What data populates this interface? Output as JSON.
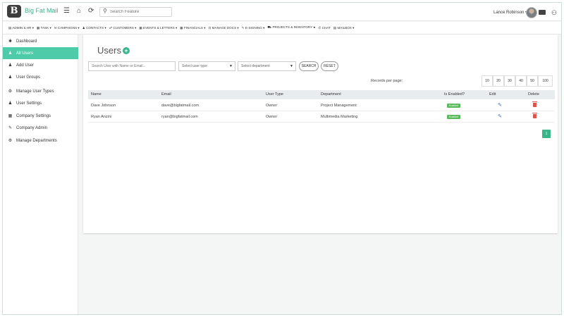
{
  "app": {
    "brand": "Big Fat Mail",
    "logo_letter": "B"
  },
  "search": {
    "placeholder": "Search Feature"
  },
  "user": {
    "name": "Lance Robinson ▾"
  },
  "nav": [
    "▤ ADMIN & HR ▾",
    "▦ TASK ▾",
    "✉ CAMPAIGNS ▾",
    "♟ CONTACTS ▾",
    "☍ CUSTOMERS ▾",
    "▦ EVENTS & LETTERS ▾",
    "▦ FINANCIALS ▾",
    "⊡ MANAGE DOCS ▾",
    "✎ E-SIGNING ▾",
    "⛟ PROJECTS & INVENTORY ▾",
    "✆ CHAT",
    "▤ MAILBOX ▾"
  ],
  "sidebar": [
    {
      "icon": "✱",
      "label": "Dashboard"
    },
    {
      "icon": "♟",
      "label": "All Users"
    },
    {
      "icon": "♟",
      "label": "Add User"
    },
    {
      "icon": "♟",
      "label": "User Groups"
    },
    {
      "icon": "⚙",
      "label": "Manage User Types"
    },
    {
      "icon": "♟",
      "label": "User Settings"
    },
    {
      "icon": "▦",
      "label": "Company Settings"
    },
    {
      "icon": "✎",
      "label": "Company Admin"
    },
    {
      "icon": "⚙",
      "label": "Manage Departments"
    }
  ],
  "main": {
    "title": "Users",
    "filters": {
      "search_placeholder": "Search User with Name or Email...",
      "user_type": "Select user type",
      "department": "Select department",
      "search_button": "SEARCH",
      "reset_button": "RESET"
    },
    "records_label": "Records per page:",
    "records_options": [
      "10",
      "20",
      "30",
      "40",
      "50",
      "100"
    ],
    "columns": [
      "Name",
      "Email",
      "User Type",
      "Department",
      "Is Enabled?",
      "Edit",
      "Delete"
    ],
    "rows": [
      {
        "name": "Dave Johnson",
        "email": "dave@bigfatmail.com",
        "type": "Owner",
        "department": "Project Management",
        "enabled": "Enabled"
      },
      {
        "name": "Ryan Anzini",
        "email": "ryan@bigfatmail.com",
        "type": "Owner",
        "department": "Multimedia Marketing",
        "enabled": "Enabled"
      }
    ],
    "pagination": [
      "1"
    ]
  }
}
